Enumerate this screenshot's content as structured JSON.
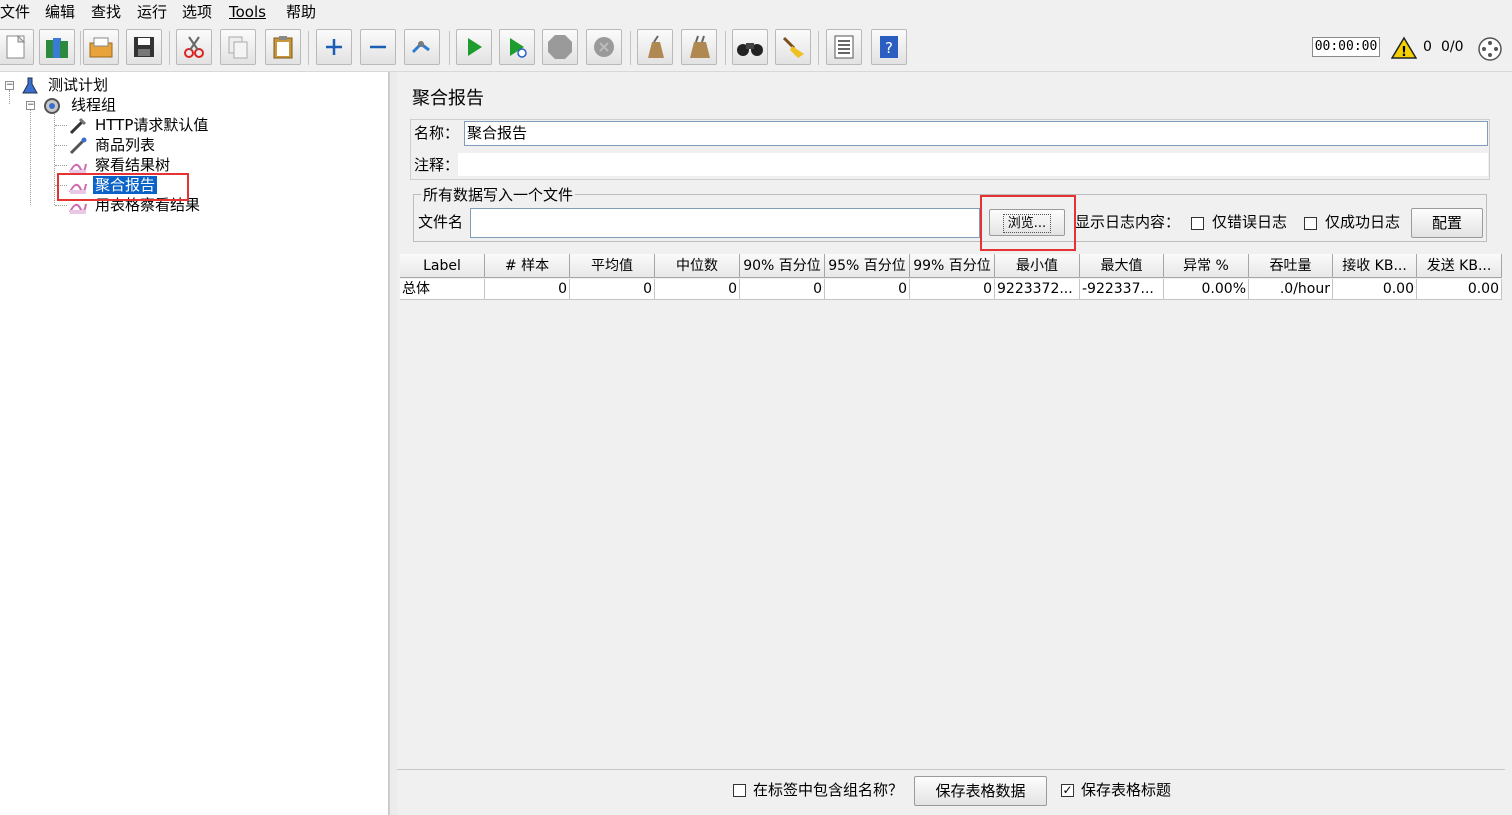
{
  "menubar": {
    "items": [
      "文件",
      "编辑",
      "查找",
      "运行",
      "选项",
      "Tools",
      "帮助"
    ]
  },
  "toolbar": {
    "icons": [
      "new-icon",
      "templates-icon",
      "open-icon",
      "save-icon",
      "cut-icon",
      "copy-icon",
      "paste-icon",
      "expand-icon",
      "collapse-icon",
      "toggle-icon",
      "start-icon",
      "start-no-pause-icon",
      "stop-icon",
      "shutdown-icon",
      "clear-icon",
      "clear-all-icon",
      "search-icon",
      "reset-search-icon",
      "function-helper-icon",
      "help-icon"
    ],
    "timer": "00:00:00",
    "warning_count": "0",
    "threads": "0/0"
  },
  "tree": {
    "root": "测试计划",
    "thread_group": "线程组",
    "children": [
      "HTTP请求默认值",
      "商品列表",
      "察看结果树",
      "聚合报告",
      "用表格察看结果"
    ],
    "selected": "聚合报告"
  },
  "panel": {
    "title": "聚合报告",
    "name_label": "名称：",
    "name_value": "聚合报告",
    "comment_label": "注释：",
    "comment_value": "",
    "file_group_title": "所有数据写入一个文件",
    "filename_label": "文件名",
    "filename_value": "",
    "browse_label": "浏览...",
    "log_content_label": "显示日志内容：",
    "errors_only_label": "仅错误日志",
    "success_only_label": "仅成功日志",
    "configure_label": "配置"
  },
  "table": {
    "headers": [
      "Label",
      "# 样本",
      "平均值",
      "中位数",
      "90% 百分位",
      "95% 百分位",
      "99% 百分位",
      "最小值",
      "最大值",
      "异常 %",
      "吞吐量",
      "接收 KB...",
      "发送 KB..."
    ],
    "rows": [
      [
        "总体",
        "0",
        "0",
        "0",
        "0",
        "0",
        "0",
        "9223372...",
        "-922337...",
        "0.00%",
        ".0/hour",
        "0.00",
        "0.00"
      ]
    ]
  },
  "bottom": {
    "include_group_label": "在标签中包含组名称？",
    "save_table_data_label": "保存表格数据",
    "save_table_header_label": "保存表格标题",
    "include_group_checked": false,
    "save_header_checked": true
  },
  "colors": {
    "selection": "#0a63c9",
    "highlight_box": "#e53333"
  }
}
